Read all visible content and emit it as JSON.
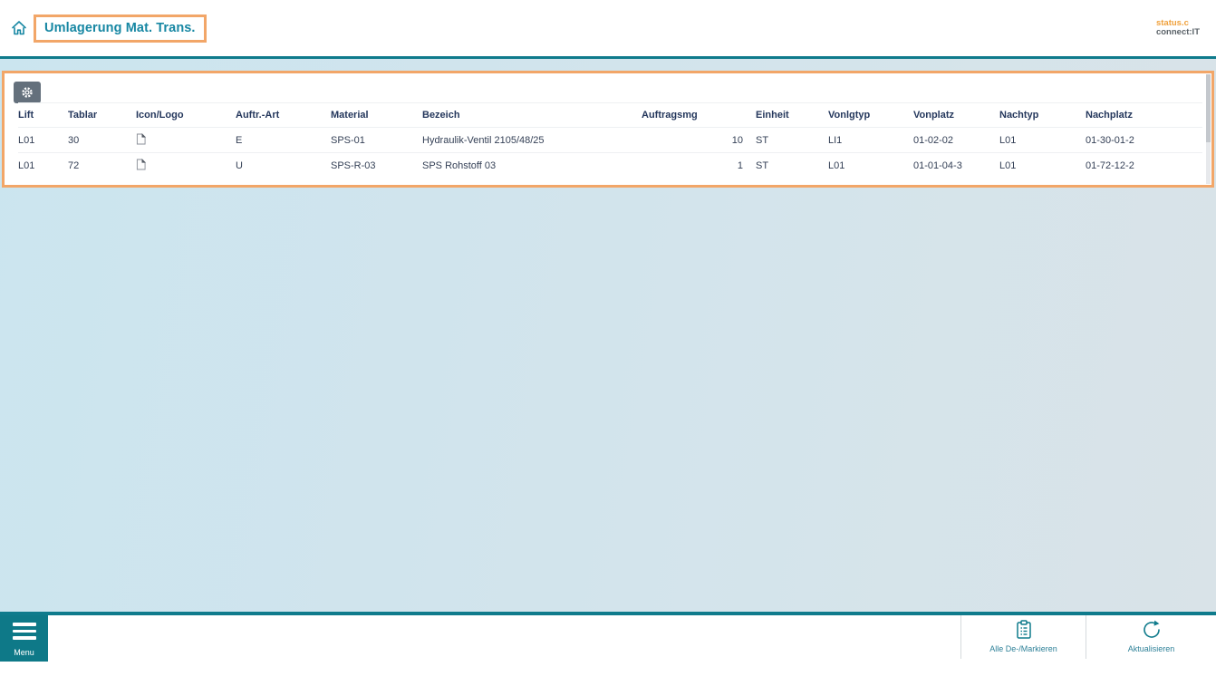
{
  "header": {
    "title": "Umlagerung Mat. Trans.",
    "logo_line1": "status.c",
    "logo_line2": "connect:IT"
  },
  "table": {
    "columns": [
      "Lift",
      "Tablar",
      "Icon/Logo",
      "Auftr.-Art",
      "Material",
      "Bezeich",
      "Auftragsmg",
      "Einheit",
      "Vonlgtyp",
      "Vonplatz",
      "Nachtyp",
      "Nachplatz"
    ],
    "rows": [
      {
        "lift": "L01",
        "tablar": "30",
        "icon": "document-icon",
        "auftr_art": "E",
        "material": "SPS-01",
        "bezeich": "Hydraulik-Ventil 2105/48/25",
        "auftragsmg": "10",
        "einheit": "ST",
        "vonlgtyp": "LI1",
        "vonplatz": "01-02-02",
        "nachtyp": "L01",
        "nachplatz": "01-30-01-2"
      },
      {
        "lift": "L01",
        "tablar": "72",
        "icon": "document-icon",
        "auftr_art": "U",
        "material": "SPS-R-03",
        "bezeich": "SPS Rohstoff 03",
        "auftragsmg": "1",
        "einheit": "ST",
        "vonlgtyp": "L01",
        "vonplatz": "01-01-04-3",
        "nachtyp": "L01",
        "nachplatz": "01-72-12-2"
      }
    ]
  },
  "footer": {
    "menu_label": "Menu",
    "mark_all_label": "Alle De-/Markieren",
    "refresh_label": "Aktualisieren"
  },
  "colors": {
    "accent_teal": "#0F7B8C",
    "title_teal": "#1787A3",
    "highlight_orange": "#F2A668",
    "logo_orange": "#F0A13C",
    "header_navy": "#24375C",
    "gear_button_gray": "#64707C"
  }
}
